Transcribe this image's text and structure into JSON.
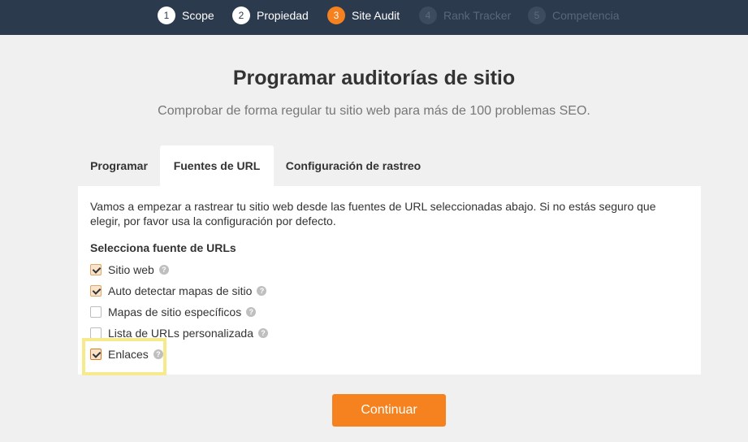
{
  "steps": [
    {
      "num": "1",
      "label": "Scope",
      "state": "done"
    },
    {
      "num": "2",
      "label": "Propiedad",
      "state": "done"
    },
    {
      "num": "3",
      "label": "Site Audit",
      "state": "active"
    },
    {
      "num": "4",
      "label": "Rank Tracker",
      "state": "future"
    },
    {
      "num": "5",
      "label": "Competencia",
      "state": "future"
    }
  ],
  "page": {
    "title": "Programar auditorías de sitio",
    "subtitle": "Comprobar de forma regular tu sitio web para más de 100 problemas SEO."
  },
  "tabs": [
    {
      "label": "Programar",
      "active": false
    },
    {
      "label": "Fuentes de URL",
      "active": true
    },
    {
      "label": "Configuración de rastreo",
      "active": false
    }
  ],
  "panel": {
    "intro": "Vamos a empezar a rastrear tu sitio web desde las fuentes de URL seleccionadas abajo. Si no estás seguro que elegir, por favor usa la configuración por defecto.",
    "section_title": "Selecciona fuente de URLs",
    "options": [
      {
        "label": "Sitio web",
        "checked": true
      },
      {
        "label": "Auto detectar mapas de sitio",
        "checked": true
      },
      {
        "label": "Mapas de sitio específicos",
        "checked": false
      },
      {
        "label": "Lista de URLs personalizada",
        "checked": false
      },
      {
        "label": "Enlaces",
        "checked": true
      }
    ],
    "help_glyph": "?"
  },
  "actions": {
    "continue_label": "Continuar"
  },
  "colors": {
    "header_bg": "#2c3a4e",
    "accent": "#f5821f",
    "highlight": "#f7ea8c"
  }
}
